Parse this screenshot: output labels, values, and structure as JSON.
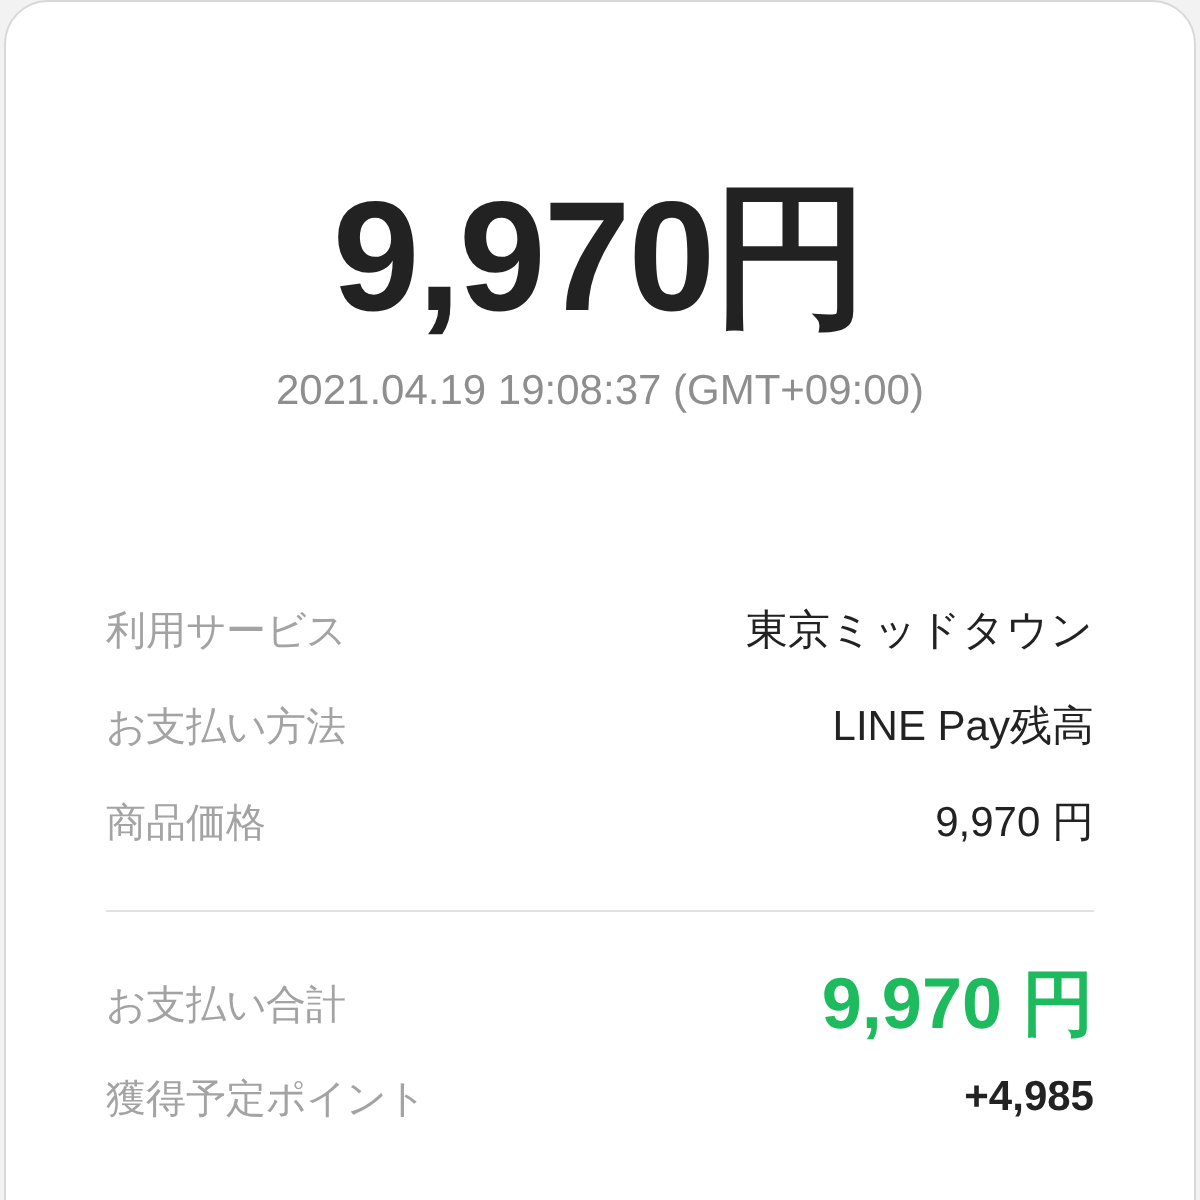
{
  "amount": "9,970円",
  "datetime": "2021.04.19 19:08:37 (GMT+09:00)",
  "details": [
    {
      "label": "利用サービス",
      "value": "東京ミッドタウン"
    },
    {
      "label": "お支払い方法",
      "value": "LINE Pay残高"
    },
    {
      "label": "商品価格",
      "value": "9,970 円"
    }
  ],
  "totals": [
    {
      "kind": "total",
      "label": "お支払い合計",
      "value": "9,970 円"
    },
    {
      "kind": "points",
      "label": "獲得予定ポイント",
      "value": "+4,985"
    }
  ]
}
